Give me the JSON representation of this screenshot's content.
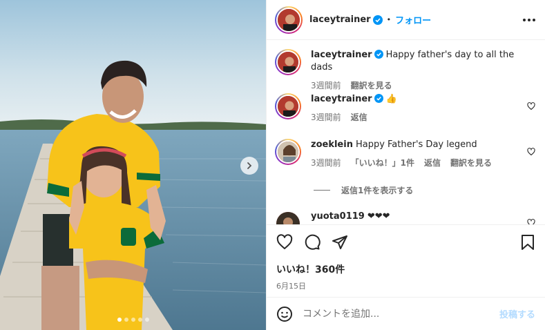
{
  "post": {
    "username": "laceytrainer",
    "follow_label": "フォロー",
    "separator": "•",
    "dot_count": 5,
    "active_dot": 0
  },
  "comments": [
    {
      "username": "laceytrainer",
      "verified": true,
      "text": "Happy father's day to all the dads",
      "time": "3週間前",
      "actions": [
        "翻訳を見る"
      ],
      "has_like": false
    },
    {
      "username": "laceytrainer",
      "verified": true,
      "text": "👍",
      "time": "3週間前",
      "actions": [
        "返信"
      ],
      "has_like": true
    },
    {
      "username": "zoeklein",
      "verified": false,
      "text": "Happy Father's Day legend",
      "time": "3週間前",
      "actions": [
        "「いいね！」1件",
        "返信",
        "翻訳を見る"
      ],
      "has_like": true,
      "replies_label": "返信1件を表示する"
    },
    {
      "username": "yuota0119",
      "verified": false,
      "text": "❤❤❤",
      "has_like": true
    }
  ],
  "likes_label": "いいね！360件",
  "date_label": "6月15日",
  "comment_box": {
    "placeholder": "コメントを追加...",
    "post_label": "投稿する"
  },
  "colors": {
    "link_blue": "#0095f6",
    "post_disabled": "#b3dbff",
    "verified_blue": "#0095f6",
    "jersey_yellow": "#f7c31a",
    "jersey_green": "#0b6b3a"
  },
  "icons": {
    "like": "heart-icon",
    "comment": "comment-icon",
    "share": "paper-plane-icon",
    "save": "bookmark-icon",
    "more": "more-options-icon",
    "emoji": "emoji-icon",
    "next": "chevron-right-icon"
  }
}
